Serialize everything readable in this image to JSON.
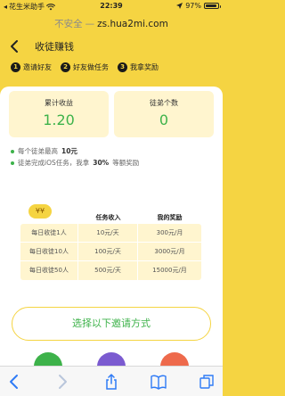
{
  "status_bar": {
    "carrier": "花生米助手",
    "time": "22:39",
    "battery_percent": "97%"
  },
  "address_bar": {
    "insecure_label": "不安全",
    "separator": "—",
    "host": "zs.hua2mi.com"
  },
  "header": {
    "back_icon": "chevron-left-icon",
    "title": "收徒赚钱"
  },
  "steps": [
    {
      "num": "1",
      "label": "邀请好友"
    },
    {
      "num": "2",
      "label": "好友做任务"
    },
    {
      "num": "3",
      "label": "我拿奖励"
    }
  ],
  "stats": [
    {
      "label": "累计收益",
      "value": "1.20"
    },
    {
      "label": "徒弟个数",
      "value": "0"
    }
  ],
  "notes": {
    "line1_prefix": "每个徒弟最高",
    "line1_amount": "10元",
    "line2_prefix": "徒弟完成iOS任务，我拿",
    "line2_percent": "30%",
    "line2_suffix": "等额奖励"
  },
  "table": {
    "coin_glyphs": "¥¥",
    "headers": [
      "",
      "任务收入",
      "我的奖励"
    ],
    "rows": [
      [
        "每日收徒1人",
        "10元/天",
        "300元/月"
      ],
      [
        "每日收徒10人",
        "100元/天",
        "3000元/月"
      ],
      [
        "每日收徒50人",
        "500元/天",
        "15000元/月"
      ]
    ]
  },
  "invite_button": "选择以下邀请方式",
  "share_options": [
    {
      "icon": "wechat-icon",
      "color": "#3DB24A"
    },
    {
      "icon": "moments-icon",
      "color": "#7B5BD0"
    },
    {
      "icon": "weibo-icon",
      "color": "#EE6A4C"
    }
  ],
  "toolbar": {
    "icons": [
      "back-icon",
      "forward-icon",
      "share-icon",
      "bookmarks-icon",
      "tabs-icon"
    ]
  },
  "colors": {
    "brand_yellow": "#F5D442",
    "accent_green": "#3DB24A",
    "card_bg": "#FFF5CF",
    "link_blue": "#2F7BF6"
  }
}
